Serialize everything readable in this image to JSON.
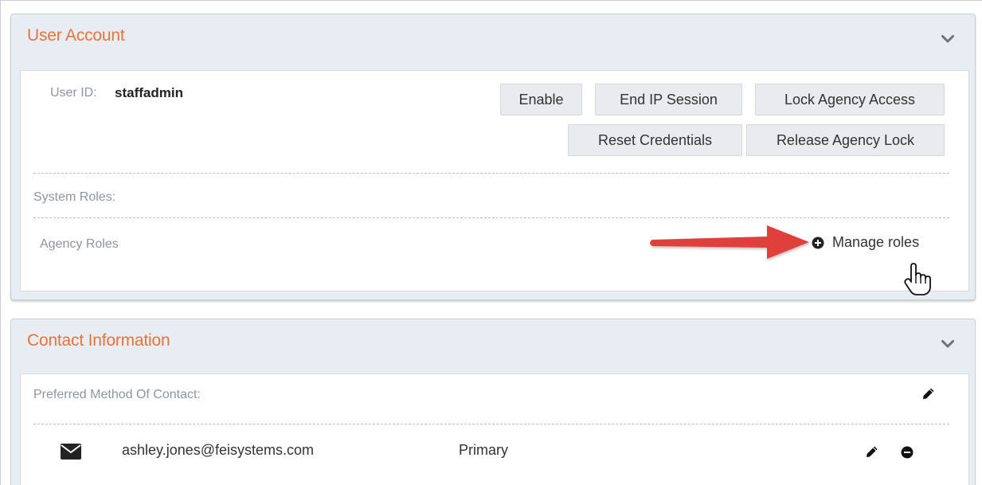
{
  "user_account": {
    "title": "User Account",
    "user_id_label": "User ID:",
    "user_id_value": "staffadmin",
    "buttons": {
      "enable": "Enable",
      "end_ip_session": "End IP Session",
      "lock_agency_access": "Lock Agency Access",
      "reset_credentials": "Reset Credentials",
      "release_agency_lock": "Release Agency Lock"
    },
    "system_roles_label": "System Roles:",
    "agency_roles_label": "Agency Roles",
    "manage_roles_label": "Manage roles"
  },
  "contact_information": {
    "title": "Contact Information",
    "preferred_method_label": "Preferred Method Of Contact:",
    "contacts": [
      {
        "icon": "envelope-icon",
        "value": "ashley.jones@feisystems.com",
        "type": "Primary"
      }
    ]
  },
  "colors": {
    "accent_title": "#e8733a",
    "panel_bg": "#e8edf3",
    "annotation_arrow": "#e0403a"
  },
  "icons": [
    "chevron-down-icon",
    "plus-circle-icon",
    "pointer-hand-icon",
    "pencil-icon",
    "envelope-icon",
    "minus-circle-icon",
    "annotation-arrow"
  ]
}
